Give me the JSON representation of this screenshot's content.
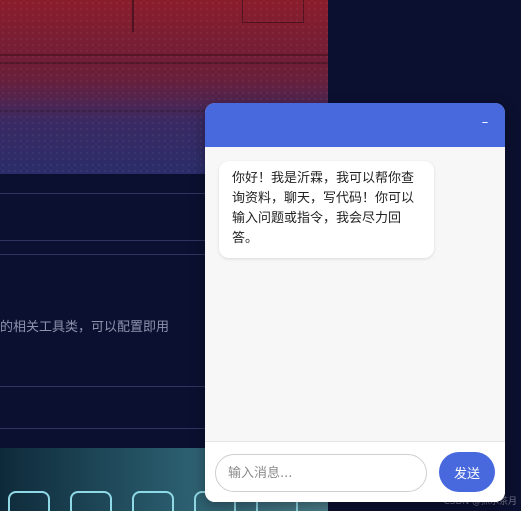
{
  "background": {
    "partial_text": "的相关工具类，可以配置即用",
    "watermark": "CSDN @抓水茶月"
  },
  "chat": {
    "minimize_icon": "minimize-icon",
    "minimize_glyph": "–",
    "messages": [
      {
        "role": "bot",
        "text": "你好！我是沂霖，我可以帮你查询资料，聊天，写代码！你可以输入问题或指令，我会尽力回答。"
      }
    ],
    "input": {
      "placeholder": "输入消息...",
      "value": ""
    },
    "send_label": "发送"
  },
  "colors": {
    "accent": "#4868de",
    "page_bg": "#0b1030",
    "chat_bg": "#f7f7f7"
  }
}
